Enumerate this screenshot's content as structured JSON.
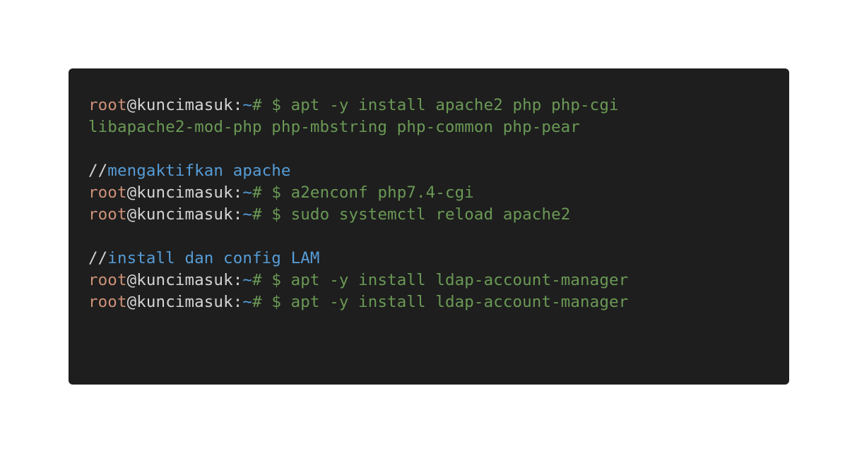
{
  "prompt": {
    "user": "root",
    "at": "@",
    "host": "kuncimasuk",
    "colon": ":",
    "tilde": "~",
    "hash": "#",
    "dollar": " $ "
  },
  "lines": [
    {
      "type": "cmd",
      "text": "apt -y install apache2 php php-cgi"
    },
    {
      "type": "cont",
      "text": "libapache2-mod-php php-mbstring php-common php-pear"
    },
    {
      "type": "blank"
    },
    {
      "type": "comment",
      "slashes": "//",
      "text": "mengaktifkan apache"
    },
    {
      "type": "cmd",
      "text": "a2enconf php7.4-cgi"
    },
    {
      "type": "cmd",
      "text": "sudo systemctl reload apache2"
    },
    {
      "type": "blank"
    },
    {
      "type": "comment",
      "slashes": "//",
      "text": "install dan config LAM"
    },
    {
      "type": "cmd",
      "text": "apt -y install ldap-account-manager"
    },
    {
      "type": "cmd",
      "text": "apt -y install ldap-account-manager"
    }
  ],
  "colors": {
    "background": "#1e1e1e",
    "user": "#ce9178",
    "command": "#6a9955",
    "comment": "#569cd6",
    "text": "#d4d4d4"
  }
}
